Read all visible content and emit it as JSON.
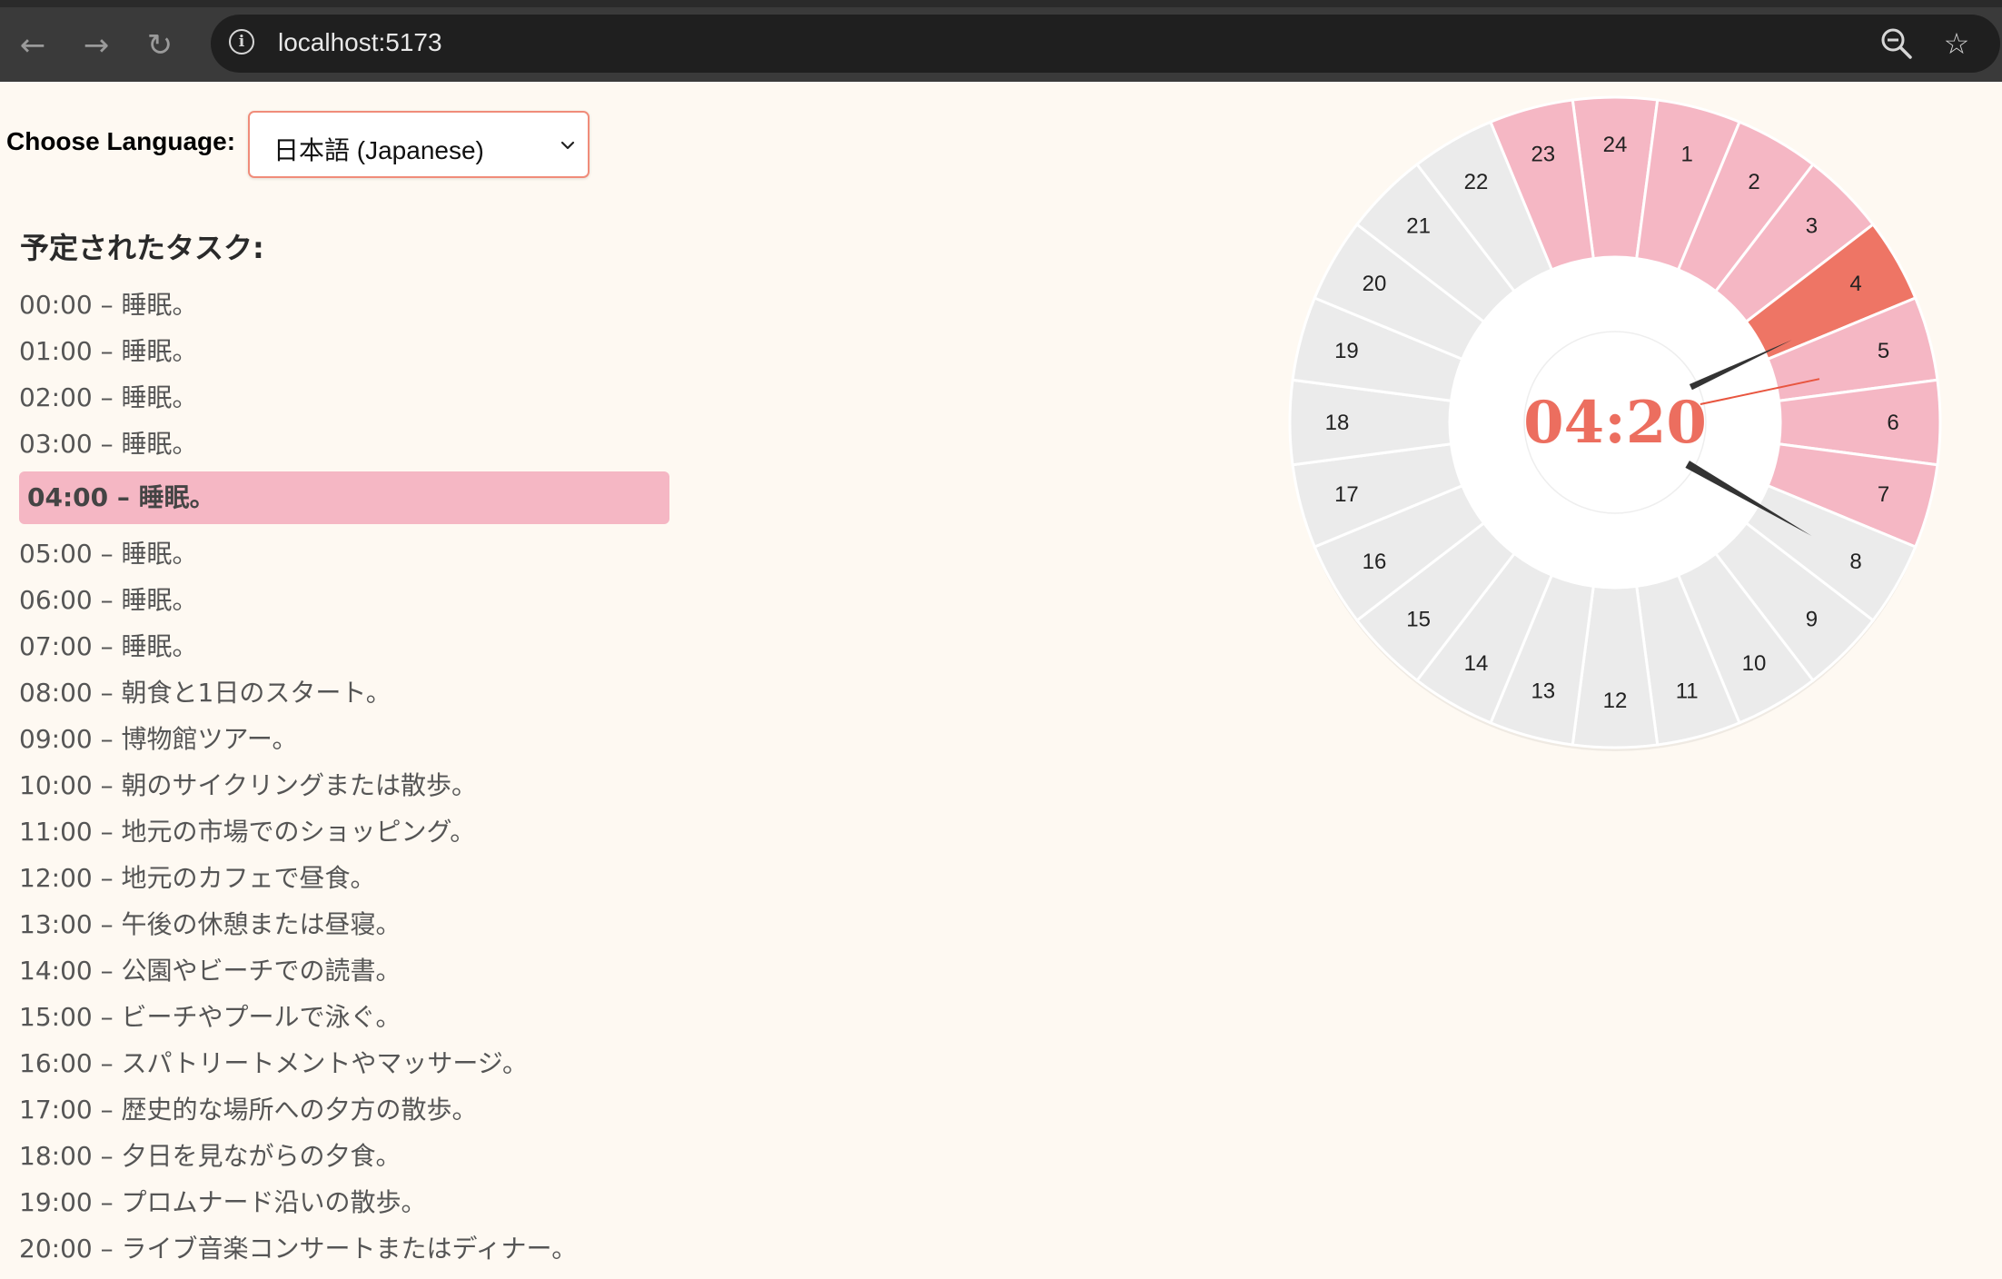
{
  "browser": {
    "url": "localhost:5173",
    "back_icon": "arrow-left-icon",
    "forward_icon": "arrow-right-icon",
    "reload_icon": "reload-icon",
    "info_icon": "info-icon",
    "zoom_icon": "zoom-out-icon",
    "bookmark_icon": "star-icon"
  },
  "language": {
    "label": "Choose Language:",
    "selected": "日本語 (Japanese)"
  },
  "schedule": {
    "heading": "予定されたタスク:",
    "current_index": 4,
    "tasks": [
      {
        "time": "00:00",
        "text": "睡眠。"
      },
      {
        "time": "01:00",
        "text": "睡眠。"
      },
      {
        "time": "02:00",
        "text": "睡眠。"
      },
      {
        "time": "03:00",
        "text": "睡眠。"
      },
      {
        "time": "04:00",
        "text": "睡眠。"
      },
      {
        "time": "05:00",
        "text": "睡眠。"
      },
      {
        "time": "06:00",
        "text": "睡眠。"
      },
      {
        "time": "07:00",
        "text": "睡眠。"
      },
      {
        "time": "08:00",
        "text": "朝食と1日のスタート。"
      },
      {
        "time": "09:00",
        "text": "博物館ツアー。"
      },
      {
        "time": "10:00",
        "text": "朝のサイクリングまたは散歩。"
      },
      {
        "time": "11:00",
        "text": "地元の市場でのショッピング。"
      },
      {
        "time": "12:00",
        "text": "地元のカフェで昼食。"
      },
      {
        "time": "13:00",
        "text": "午後の休憩または昼寝。"
      },
      {
        "time": "14:00",
        "text": "公園やビーチでの読書。"
      },
      {
        "time": "15:00",
        "text": "ビーチやプールで泳ぐ。"
      },
      {
        "time": "16:00",
        "text": "スパトリートメントやマッサージ。"
      },
      {
        "time": "17:00",
        "text": "歴史的な場所への夕方の散歩。"
      },
      {
        "time": "18:00",
        "text": "夕日を見ながらの夕食。"
      },
      {
        "time": "19:00",
        "text": "プロムナード沿いの散歩。"
      },
      {
        "time": "20:00",
        "text": "ライブ音楽コンサートまたはディナー。"
      }
    ]
  },
  "clock": {
    "time": "04:20",
    "hour": 4,
    "minute": 20,
    "second": 13,
    "hours": [
      "24",
      "1",
      "2",
      "3",
      "4",
      "5",
      "6",
      "7",
      "8",
      "9",
      "10",
      "11",
      "12",
      "13",
      "14",
      "15",
      "16",
      "17",
      "18",
      "19",
      "20",
      "21",
      "22",
      "23"
    ],
    "sleep_hours": [
      23,
      24,
      1,
      2,
      3,
      4,
      5,
      6,
      7
    ],
    "current_hour": 4,
    "colors": {
      "sleep": "#f5b7c4",
      "current": "#ee7565",
      "other": "#ebebeb",
      "time_text": "#ec6e5f",
      "hands": "#333333",
      "second_hand": "#e8553f"
    }
  }
}
